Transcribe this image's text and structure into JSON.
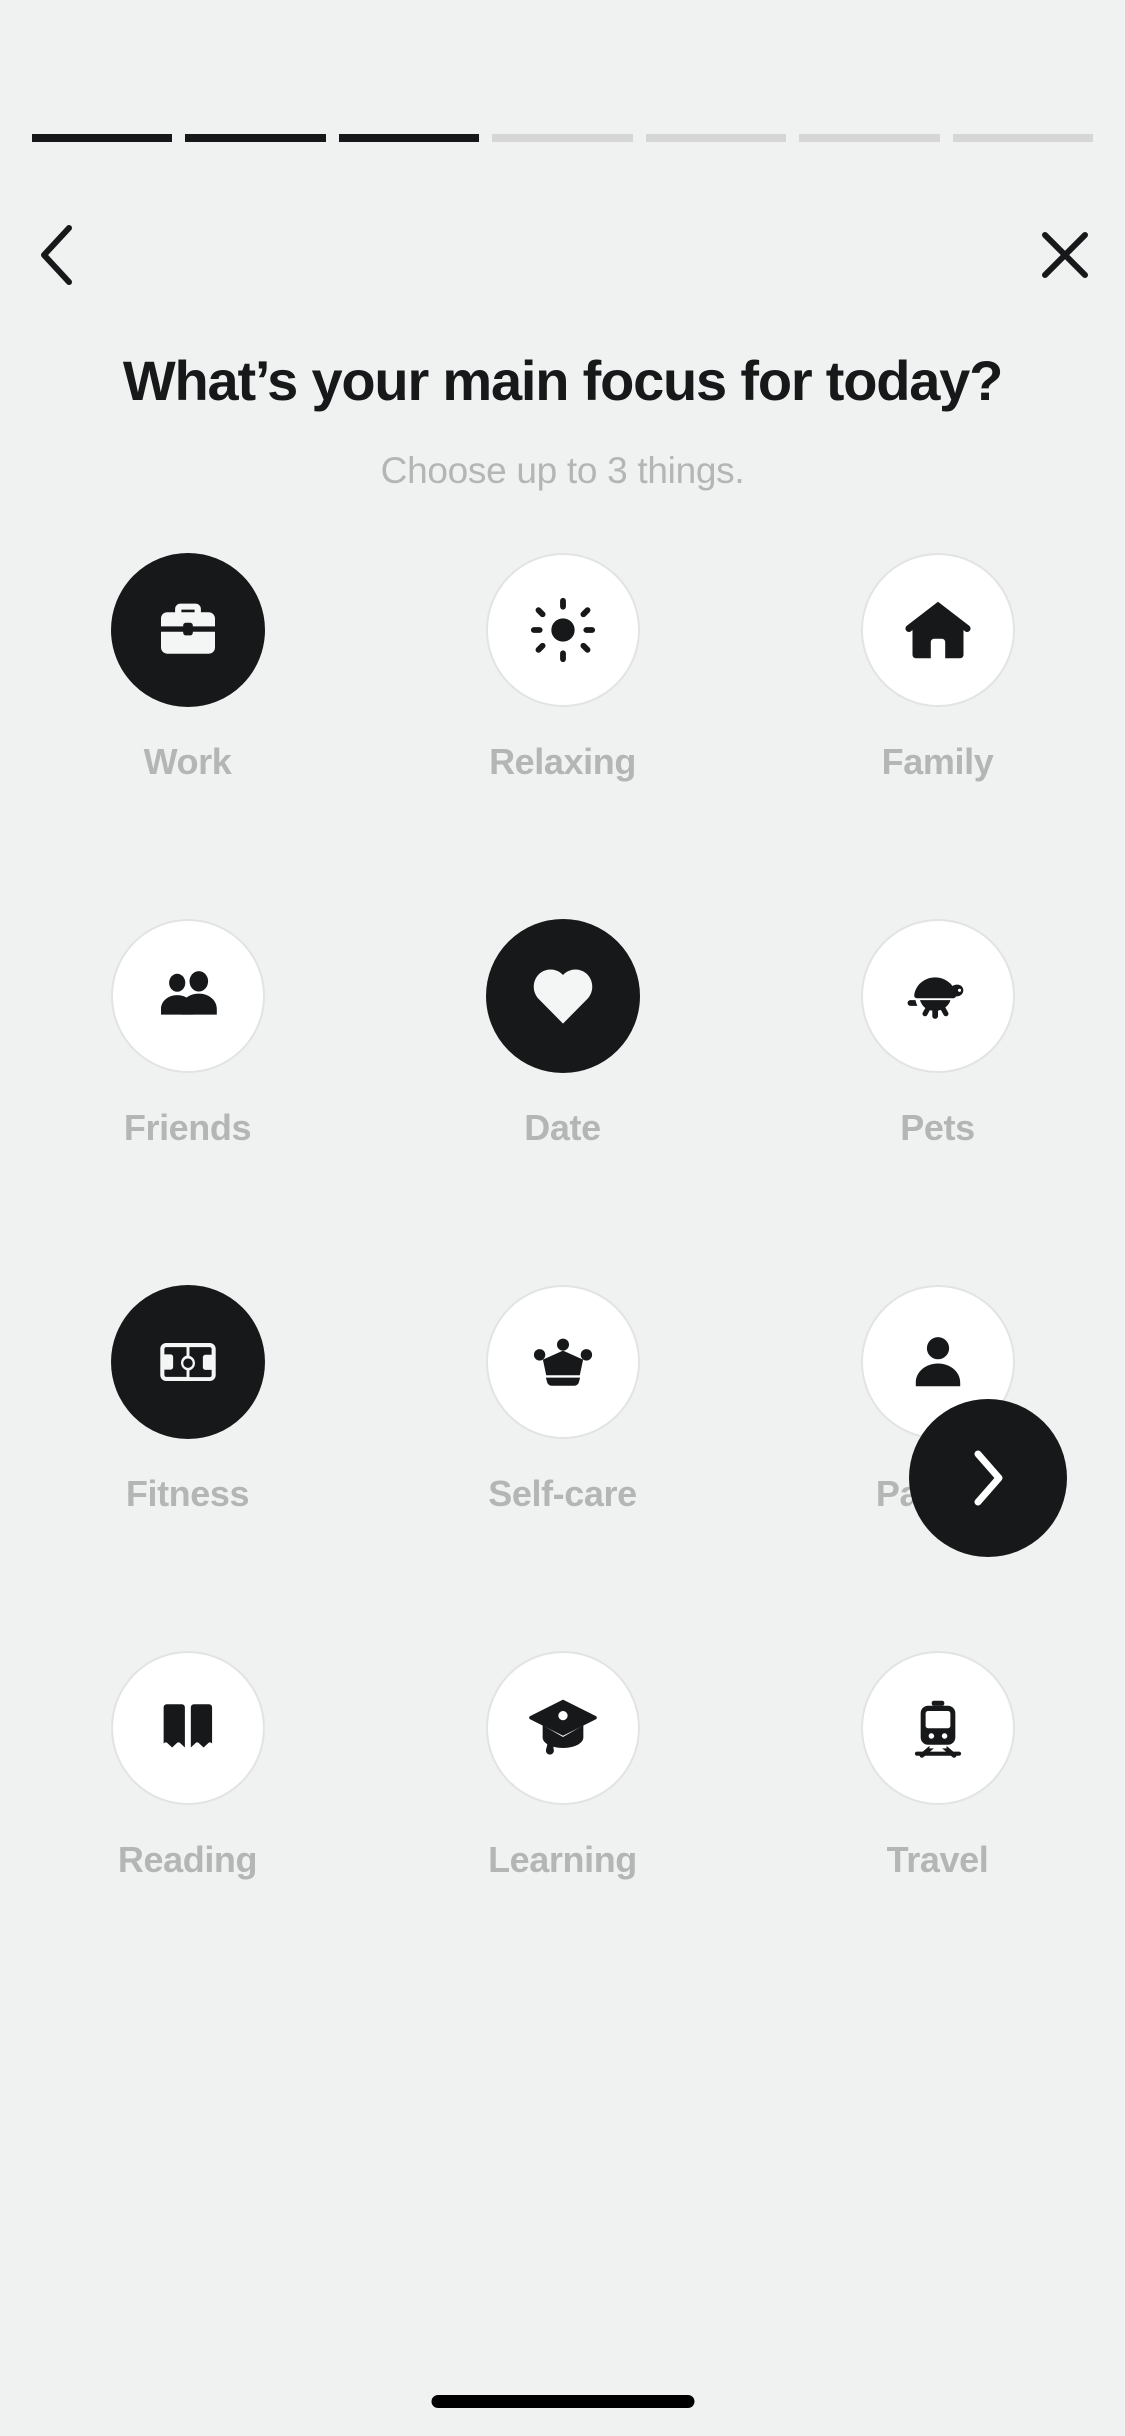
{
  "progress": {
    "total_segments": 7,
    "filled_segments": 3
  },
  "nav": {
    "back_label": "Back",
    "back_icon": "chevron-left-icon",
    "close_label": "Close",
    "close_icon": "close-x-icon"
  },
  "header": {
    "title": "What’s your main focus for today?",
    "subtitle": "Choose up to 3 things."
  },
  "options": [
    {
      "label": "Work",
      "icon": "briefcase-icon",
      "selected": true
    },
    {
      "label": "Relaxing",
      "icon": "sun-icon",
      "selected": false
    },
    {
      "label": "Family",
      "icon": "home-icon",
      "selected": false
    },
    {
      "label": "Friends",
      "icon": "people-icon",
      "selected": false
    },
    {
      "label": "Date",
      "icon": "heart-icon",
      "selected": true
    },
    {
      "label": "Pets",
      "icon": "turtle-icon",
      "selected": false
    },
    {
      "label": "Fitness",
      "icon": "sports-field-icon",
      "selected": true
    },
    {
      "label": "Self-care",
      "icon": "crown-icon",
      "selected": false
    },
    {
      "label": "Partner",
      "icon": "person-icon",
      "selected": false
    },
    {
      "label": "Reading",
      "icon": "open-book-icon",
      "selected": false
    },
    {
      "label": "Learning",
      "icon": "graduation-cap-icon",
      "selected": false
    },
    {
      "label": "Travel",
      "icon": "train-icon",
      "selected": false
    }
  ],
  "next_button": {
    "label": "Next",
    "icon": "chevron-right-icon"
  },
  "colors": {
    "background": "#f0f2f1",
    "ink": "#16181a",
    "muted_text": "#b3b6b5",
    "bubble_border": "#e2e4e3",
    "progress_empty": "#d6d6d6",
    "bubble_fill": "#ffffff"
  }
}
